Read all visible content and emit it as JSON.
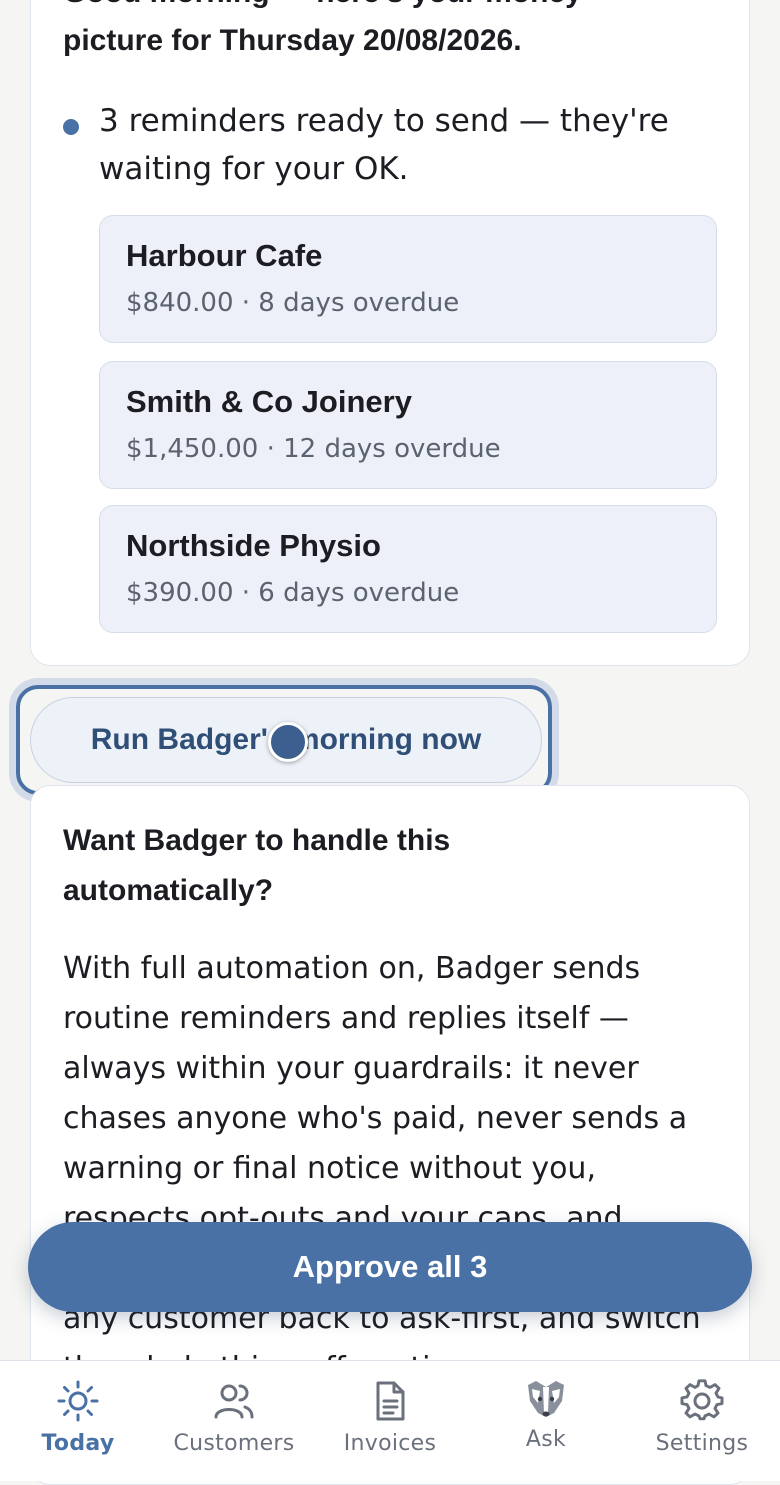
{
  "brief": {
    "greeting_line1": "Good morning — here's your money",
    "greeting_line2": "picture for Thursday 20/08/2026.",
    "bullet": "3 reminders ready to send — they're waiting for your OK.",
    "reminders": [
      {
        "name": "Harbour Cafe",
        "meta": "$840.00 · 8 days overdue"
      },
      {
        "name": "Smith & Co Joinery",
        "meta": "$1,450.00 · 12 days overdue"
      },
      {
        "name": "Northside Physio",
        "meta": "$390.00 · 6 days overdue"
      }
    ]
  },
  "run_button": "Run Badger's morning now",
  "automation": {
    "title": "Want Badger to handle this automatically?",
    "body": "With full automation on, Badger sends routine reminders and replies itself — always within your guardrails: it never chases anyone who's paid, never sends a warning or final notice without you, respects opt-outs and your caps, and pauses if anything looks wrong. You can pin any customer back to ask-first, and switch the whole thing off anytime."
  },
  "approve_button": "Approve all 3",
  "tabs": [
    {
      "label": "Today",
      "icon": "sun-icon",
      "active": true
    },
    {
      "label": "Customers",
      "icon": "people-icon",
      "active": false
    },
    {
      "label": "Invoices",
      "icon": "document-icon",
      "active": false
    },
    {
      "label": "Ask",
      "icon": "badger-icon",
      "active": false
    },
    {
      "label": "Settings",
      "icon": "gear-icon",
      "active": false
    }
  ],
  "colors": {
    "accent": "#4a71a5",
    "card": "#ffffff",
    "reminder_bg": "#edf0f8",
    "background": "#f5f5f3"
  }
}
